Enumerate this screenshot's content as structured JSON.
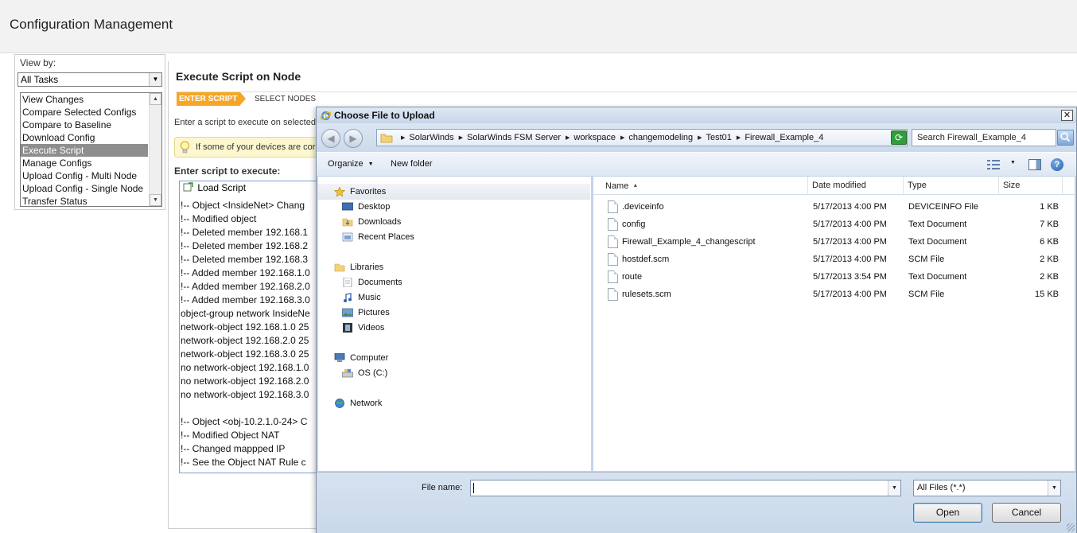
{
  "page": {
    "title": "Configuration Management"
  },
  "viewby": {
    "label": "View by:",
    "selected": "All Tasks",
    "tasks": [
      {
        "label": "View Changes",
        "selected": false
      },
      {
        "label": "Compare Selected Configs",
        "selected": false
      },
      {
        "label": "Compare to Baseline",
        "selected": false
      },
      {
        "label": "Download Config",
        "selected": false
      },
      {
        "label": "Execute Script",
        "selected": true
      },
      {
        "label": "Manage Configs",
        "selected": false
      },
      {
        "label": "Upload Config - Multi Node",
        "selected": false
      },
      {
        "label": "Upload Config - Single Node",
        "selected": false
      },
      {
        "label": "Transfer Status",
        "selected": false
      }
    ]
  },
  "main": {
    "title": "Execute Script on Node",
    "steps": [
      "ENTER SCRIPT",
      "SELECT NODES"
    ],
    "hint": "Enter a script to execute on selected",
    "tip": "If some of your devices are cor",
    "script_label": "Enter script to execute:",
    "load_script": "Load Script",
    "script_lines": [
      "!-- Object <InsideNet> Chang",
      "!-- Modified object",
      "!-- Deleted member 192.168.1",
      "!-- Deleted member 192.168.2",
      "!-- Deleted member 192.168.3",
      "!-- Added member 192.168.1.0",
      "!-- Added member 192.168.2.0",
      "!-- Added member 192.168.3.0",
      "object-group network InsideNe",
      "network-object 192.168.1.0 25",
      "network-object 192.168.2.0 25",
      "network-object 192.168.3.0 25",
      "no network-object 192.168.1.0",
      "no network-object 192.168.2.0",
      "no network-object 192.168.3.0",
      "",
      "!-- Object <obj-10.2.1.0-24> C",
      "!-- Modified Object NAT",
      "!-- Changed mappped IP",
      "!-- See the Object NAT Rule c"
    ]
  },
  "dialog": {
    "title": "Choose File to Upload",
    "close_glyph": "✕",
    "breadcrumbs": [
      "SolarWinds",
      "SolarWinds FSM Server",
      "workspace",
      "changemodeling",
      "Test01",
      "Firewall_Example_4"
    ],
    "search_placeholder": "Search Firewall_Example_4",
    "toolbar": {
      "organize": "Organize",
      "new_folder": "New folder"
    },
    "nav": {
      "favorites": "Favorites",
      "desktop": "Desktop",
      "downloads": "Downloads",
      "recent": "Recent Places",
      "libraries": "Libraries",
      "documents": "Documents",
      "music": "Music",
      "pictures": "Pictures",
      "videos": "Videos",
      "computer": "Computer",
      "os_drive": "OS (C:)",
      "network": "Network"
    },
    "columns": {
      "name": "Name",
      "date": "Date modified",
      "type": "Type",
      "size": "Size"
    },
    "files": [
      {
        "name": ".deviceinfo",
        "date": "5/17/2013 4:00 PM",
        "type": "DEVICEINFO File",
        "size": "1 KB"
      },
      {
        "name": "config",
        "date": "5/17/2013 4:00 PM",
        "type": "Text Document",
        "size": "7 KB"
      },
      {
        "name": "Firewall_Example_4_changescript",
        "date": "5/17/2013 4:00 PM",
        "type": "Text Document",
        "size": "6 KB"
      },
      {
        "name": "hostdef.scm",
        "date": "5/17/2013 4:00 PM",
        "type": "SCM File",
        "size": "2 KB"
      },
      {
        "name": "route",
        "date": "5/17/2013 3:54 PM",
        "type": "Text Document",
        "size": "2 KB"
      },
      {
        "name": "rulesets.scm",
        "date": "5/17/2013 4:00 PM",
        "type": "SCM File",
        "size": "15 KB"
      }
    ],
    "filename_label": "File name:",
    "filename_value": "",
    "filetype": "All Files (*.*)",
    "open": "Open",
    "cancel": "Cancel"
  }
}
